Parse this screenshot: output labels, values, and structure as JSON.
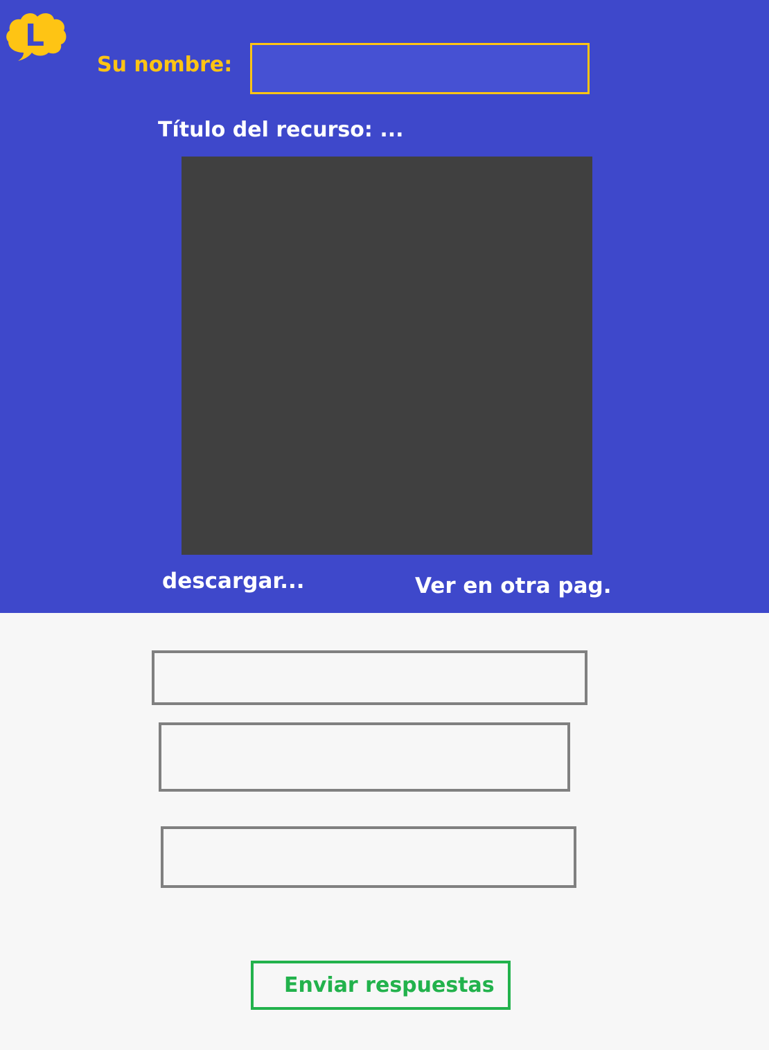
{
  "colors": {
    "header_background": "#3e48cb",
    "page_background": "#f7f7f7",
    "accent_yellow": "#fec414",
    "viewer_background": "#404040",
    "answer_border": "#808080",
    "submit_green": "#22b24c"
  },
  "logo": {
    "icon": "speech-bubble-logo-icon",
    "letter": "L"
  },
  "name_field": {
    "label": "Su nombre:",
    "value": "",
    "placeholder": ""
  },
  "resource": {
    "title": "Título del recurso: ...",
    "download_label": "descargar...",
    "open_external_label": "Ver en otra pag."
  },
  "answers": [
    {
      "value": ""
    },
    {
      "value": ""
    },
    {
      "value": ""
    }
  ],
  "submit_label": "Enviar respuestas"
}
